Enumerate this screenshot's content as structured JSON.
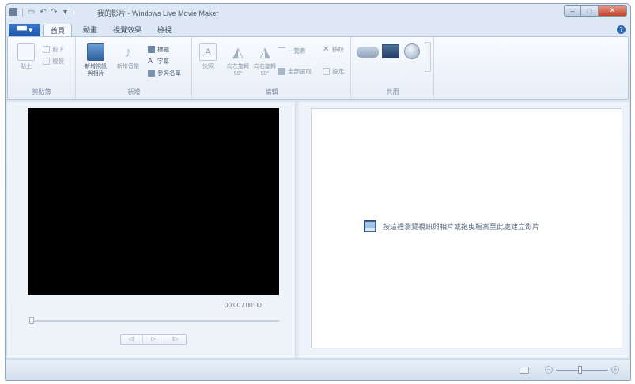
{
  "titlebar": {
    "title": "我的影片 - Windows Live Movie Maker",
    "minimize_glyph": "–",
    "maximize_glyph": "□",
    "close_glyph": "✕"
  },
  "quick_access": {
    "save_glyph": "▭",
    "undo_glyph": "↶",
    "redo_glyph": "↷",
    "dropdown_glyph": "▾"
  },
  "tabs": {
    "file_label": "▀▀ ▾",
    "items": [
      "首頁",
      "動畫",
      "視覺效果",
      "檢視"
    ],
    "help_glyph": "?"
  },
  "ribbon": {
    "clipboard": {
      "label": "剪貼簿",
      "paste": "貼上",
      "cut": "剪下",
      "copy": "複製"
    },
    "add": {
      "label": "新增",
      "add_videos_photos": "新增視訊\n與相片",
      "add_music": "新增音樂",
      "title": "標題",
      "caption": "字幕",
      "credits": "參與名單"
    },
    "editing": {
      "label": "編輯",
      "snapshot": "快照",
      "rotate_left": "向左旋轉 90°",
      "rotate_right": "向右旋轉 90°",
      "select_all": "全部選取",
      "remove": "移除",
      "set_default": "設定",
      "split": "一覽表"
    },
    "share": {
      "label": "共用"
    }
  },
  "preview": {
    "time": "00:00 / 00:00",
    "prev_frame": "◁|",
    "play": "▷",
    "next_frame": "|▷"
  },
  "storyboard": {
    "hint": "按這裡瀏覽視訊與相片或拖曳檔案至此處建立影片"
  },
  "statusbar": {
    "zoom_out": "−",
    "zoom_in": "+"
  },
  "colors": {
    "accent": "#2e69b6",
    "close_red": "#c2432c",
    "ribbon_bg": "#f1f5fb"
  }
}
